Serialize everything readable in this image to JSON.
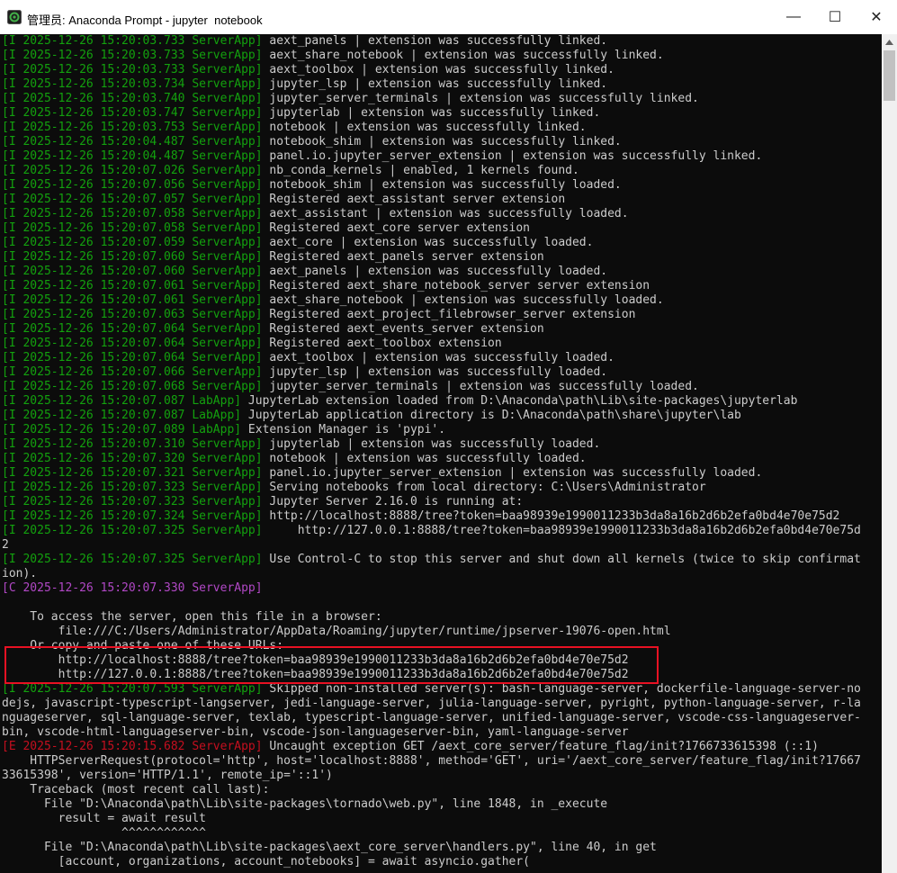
{
  "window": {
    "title": "管理员: Anaconda Prompt - jupyter  notebook",
    "icons": {
      "app": "anaconda-prompt-icon",
      "min": "minimize-icon",
      "max": "maximize-icon",
      "close": "close-icon"
    },
    "minimize_glyph": "—",
    "maximize_glyph": "☐",
    "close_glyph": "✕"
  },
  "colors": {
    "info_tag": "#13a10e",
    "critical_tag": "#b148c6",
    "error_tag": "#c50f1f",
    "text": "#cccccc",
    "background": "#0c0c0c",
    "highlight_box": "#e81123"
  },
  "lines": [
    {
      "tag": "[I 2025-12-26 15:20:03.733 ServerApp]",
      "type": "I",
      "msg": " aext_panels | extension was successfully linked."
    },
    {
      "tag": "[I 2025-12-26 15:20:03.733 ServerApp]",
      "type": "I",
      "msg": " aext_share_notebook | extension was successfully linked."
    },
    {
      "tag": "[I 2025-12-26 15:20:03.733 ServerApp]",
      "type": "I",
      "msg": " aext_toolbox | extension was successfully linked."
    },
    {
      "tag": "[I 2025-12-26 15:20:03.734 ServerApp]",
      "type": "I",
      "msg": " jupyter_lsp | extension was successfully linked."
    },
    {
      "tag": "[I 2025-12-26 15:20:03.740 ServerApp]",
      "type": "I",
      "msg": " jupyter_server_terminals | extension was successfully linked."
    },
    {
      "tag": "[I 2025-12-26 15:20:03.747 ServerApp]",
      "type": "I",
      "msg": " jupyterlab | extension was successfully linked."
    },
    {
      "tag": "[I 2025-12-26 15:20:03.753 ServerApp]",
      "type": "I",
      "msg": " notebook | extension was successfully linked."
    },
    {
      "tag": "[I 2025-12-26 15:20:04.487 ServerApp]",
      "type": "I",
      "msg": " notebook_shim | extension was successfully linked."
    },
    {
      "tag": "[I 2025-12-26 15:20:04.487 ServerApp]",
      "type": "I",
      "msg": " panel.io.jupyter_server_extension | extension was successfully linked."
    },
    {
      "tag": "[I 2025-12-26 15:20:07.026 ServerApp]",
      "type": "I",
      "msg": " nb_conda_kernels | enabled, 1 kernels found."
    },
    {
      "tag": "[I 2025-12-26 15:20:07.056 ServerApp]",
      "type": "I",
      "msg": " notebook_shim | extension was successfully loaded."
    },
    {
      "tag": "[I 2025-12-26 15:20:07.057 ServerApp]",
      "type": "I",
      "msg": " Registered aext_assistant server extension"
    },
    {
      "tag": "[I 2025-12-26 15:20:07.058 ServerApp]",
      "type": "I",
      "msg": " aext_assistant | extension was successfully loaded."
    },
    {
      "tag": "[I 2025-12-26 15:20:07.058 ServerApp]",
      "type": "I",
      "msg": " Registered aext_core server extension"
    },
    {
      "tag": "[I 2025-12-26 15:20:07.059 ServerApp]",
      "type": "I",
      "msg": " aext_core | extension was successfully loaded."
    },
    {
      "tag": "[I 2025-12-26 15:20:07.060 ServerApp]",
      "type": "I",
      "msg": " Registered aext_panels server extension"
    },
    {
      "tag": "[I 2025-12-26 15:20:07.060 ServerApp]",
      "type": "I",
      "msg": " aext_panels | extension was successfully loaded."
    },
    {
      "tag": "[I 2025-12-26 15:20:07.061 ServerApp]",
      "type": "I",
      "msg": " Registered aext_share_notebook_server server extension"
    },
    {
      "tag": "[I 2025-12-26 15:20:07.061 ServerApp]",
      "type": "I",
      "msg": " aext_share_notebook | extension was successfully loaded."
    },
    {
      "tag": "[I 2025-12-26 15:20:07.063 ServerApp]",
      "type": "I",
      "msg": " Registered aext_project_filebrowser_server extension"
    },
    {
      "tag": "[I 2025-12-26 15:20:07.064 ServerApp]",
      "type": "I",
      "msg": " Registered aext_events_server extension"
    },
    {
      "tag": "[I 2025-12-26 15:20:07.064 ServerApp]",
      "type": "I",
      "msg": " Registered aext_toolbox extension"
    },
    {
      "tag": "[I 2025-12-26 15:20:07.064 ServerApp]",
      "type": "I",
      "msg": " aext_toolbox | extension was successfully loaded."
    },
    {
      "tag": "[I 2025-12-26 15:20:07.066 ServerApp]",
      "type": "I",
      "msg": " jupyter_lsp | extension was successfully loaded."
    },
    {
      "tag": "[I 2025-12-26 15:20:07.068 ServerApp]",
      "type": "I",
      "msg": " jupyter_server_terminals | extension was successfully loaded."
    },
    {
      "tag": "[I 2025-12-26 15:20:07.087 LabApp]",
      "type": "I",
      "msg": " JupyterLab extension loaded from D:\\Anaconda\\path\\Lib\\site-packages\\jupyterlab"
    },
    {
      "tag": "[I 2025-12-26 15:20:07.087 LabApp]",
      "type": "I",
      "msg": " JupyterLab application directory is D:\\Anaconda\\path\\share\\jupyter\\lab"
    },
    {
      "tag": "[I 2025-12-26 15:20:07.089 LabApp]",
      "type": "I",
      "msg": " Extension Manager is 'pypi'."
    },
    {
      "tag": "[I 2025-12-26 15:20:07.310 ServerApp]",
      "type": "I",
      "msg": " jupyterlab | extension was successfully loaded."
    },
    {
      "tag": "[I 2025-12-26 15:20:07.320 ServerApp]",
      "type": "I",
      "msg": " notebook | extension was successfully loaded."
    },
    {
      "tag": "[I 2025-12-26 15:20:07.321 ServerApp]",
      "type": "I",
      "msg": " panel.io.jupyter_server_extension | extension was successfully loaded."
    },
    {
      "tag": "[I 2025-12-26 15:20:07.323 ServerApp]",
      "type": "I",
      "msg": " Serving notebooks from local directory: C:\\Users\\Administrator"
    },
    {
      "tag": "[I 2025-12-26 15:20:07.323 ServerApp]",
      "type": "I",
      "msg": " Jupyter Server 2.16.0 is running at:"
    },
    {
      "tag": "[I 2025-12-26 15:20:07.324 ServerApp]",
      "type": "I",
      "msg": " http://localhost:8888/tree?token=baa98939e1990011233b3da8a16b2d6b2efa0bd4e70e75d2"
    },
    {
      "tag": "[I 2025-12-26 15:20:07.325 ServerApp]",
      "type": "I",
      "msg": "     http://127.0.0.1:8888/tree?token=baa98939e1990011233b3da8a16b2d6b2efa0bd4e70e75d"
    },
    {
      "tag": "",
      "type": "",
      "msg": "2"
    },
    {
      "tag": "[I 2025-12-26 15:20:07.325 ServerApp]",
      "type": "I",
      "msg": " Use Control-C to stop this server and shut down all kernels (twice to skip confirmat"
    },
    {
      "tag": "",
      "type": "",
      "msg": "ion)."
    },
    {
      "tag": "[C 2025-12-26 15:20:07.330 ServerApp]",
      "type": "C",
      "msg": ""
    },
    {
      "tag": "",
      "type": "",
      "msg": ""
    },
    {
      "tag": "",
      "type": "",
      "msg": "    To access the server, open this file in a browser:"
    },
    {
      "tag": "",
      "type": "",
      "msg": "        file:///C:/Users/Administrator/AppData/Roaming/jupyter/runtime/jpserver-19076-open.html"
    },
    {
      "tag": "",
      "type": "",
      "msg": "    Or copy and paste one of these URLs:"
    },
    {
      "tag": "",
      "type": "",
      "msg": "        http://localhost:8888/tree?token=baa98939e1990011233b3da8a16b2d6b2efa0bd4e70e75d2"
    },
    {
      "tag": "",
      "type": "",
      "msg": "        http://127.0.0.1:8888/tree?token=baa98939e1990011233b3da8a16b2d6b2efa0bd4e70e75d2"
    },
    {
      "tag": "[I 2025-12-26 15:20:07.593 ServerApp]",
      "type": "I",
      "msg": " Skipped non-installed server(s): bash-language-server, dockerfile-language-server-no"
    },
    {
      "tag": "",
      "type": "",
      "msg": "dejs, javascript-typescript-langserver, jedi-language-server, julia-language-server, pyright, python-language-server, r-la"
    },
    {
      "tag": "",
      "type": "",
      "msg": "nguageserver, sql-language-server, texlab, typescript-language-server, unified-language-server, vscode-css-languageserver-"
    },
    {
      "tag": "",
      "type": "",
      "msg": "bin, vscode-html-languageserver-bin, vscode-json-languageserver-bin, yaml-language-server"
    },
    {
      "tag": "[E 2025-12-26 15:20:15.682 ServerApp]",
      "type": "E",
      "msg": " Uncaught exception GET /aext_core_server/feature_flag/init?1766733615398 (::1)"
    },
    {
      "tag": "",
      "type": "",
      "msg": "    HTTPServerRequest(protocol='http', host='localhost:8888', method='GET', uri='/aext_core_server/feature_flag/init?17667"
    },
    {
      "tag": "",
      "type": "",
      "msg": "33615398', version='HTTP/1.1', remote_ip='::1')"
    },
    {
      "tag": "",
      "type": "",
      "msg": "    Traceback (most recent call last):"
    },
    {
      "tag": "",
      "type": "",
      "msg": "      File \"D:\\Anaconda\\path\\Lib\\site-packages\\tornado\\web.py\", line 1848, in _execute"
    },
    {
      "tag": "",
      "type": "",
      "msg": "        result = await result"
    },
    {
      "tag": "",
      "type": "",
      "msg": "                 ^^^^^^^^^^^^"
    },
    {
      "tag": "",
      "type": "",
      "msg": "      File \"D:\\Anaconda\\path\\Lib\\site-packages\\aext_core_server\\handlers.py\", line 40, in get"
    },
    {
      "tag": "",
      "type": "",
      "msg": "        [account, organizations, account_notebooks] = await asyncio.gather("
    }
  ]
}
